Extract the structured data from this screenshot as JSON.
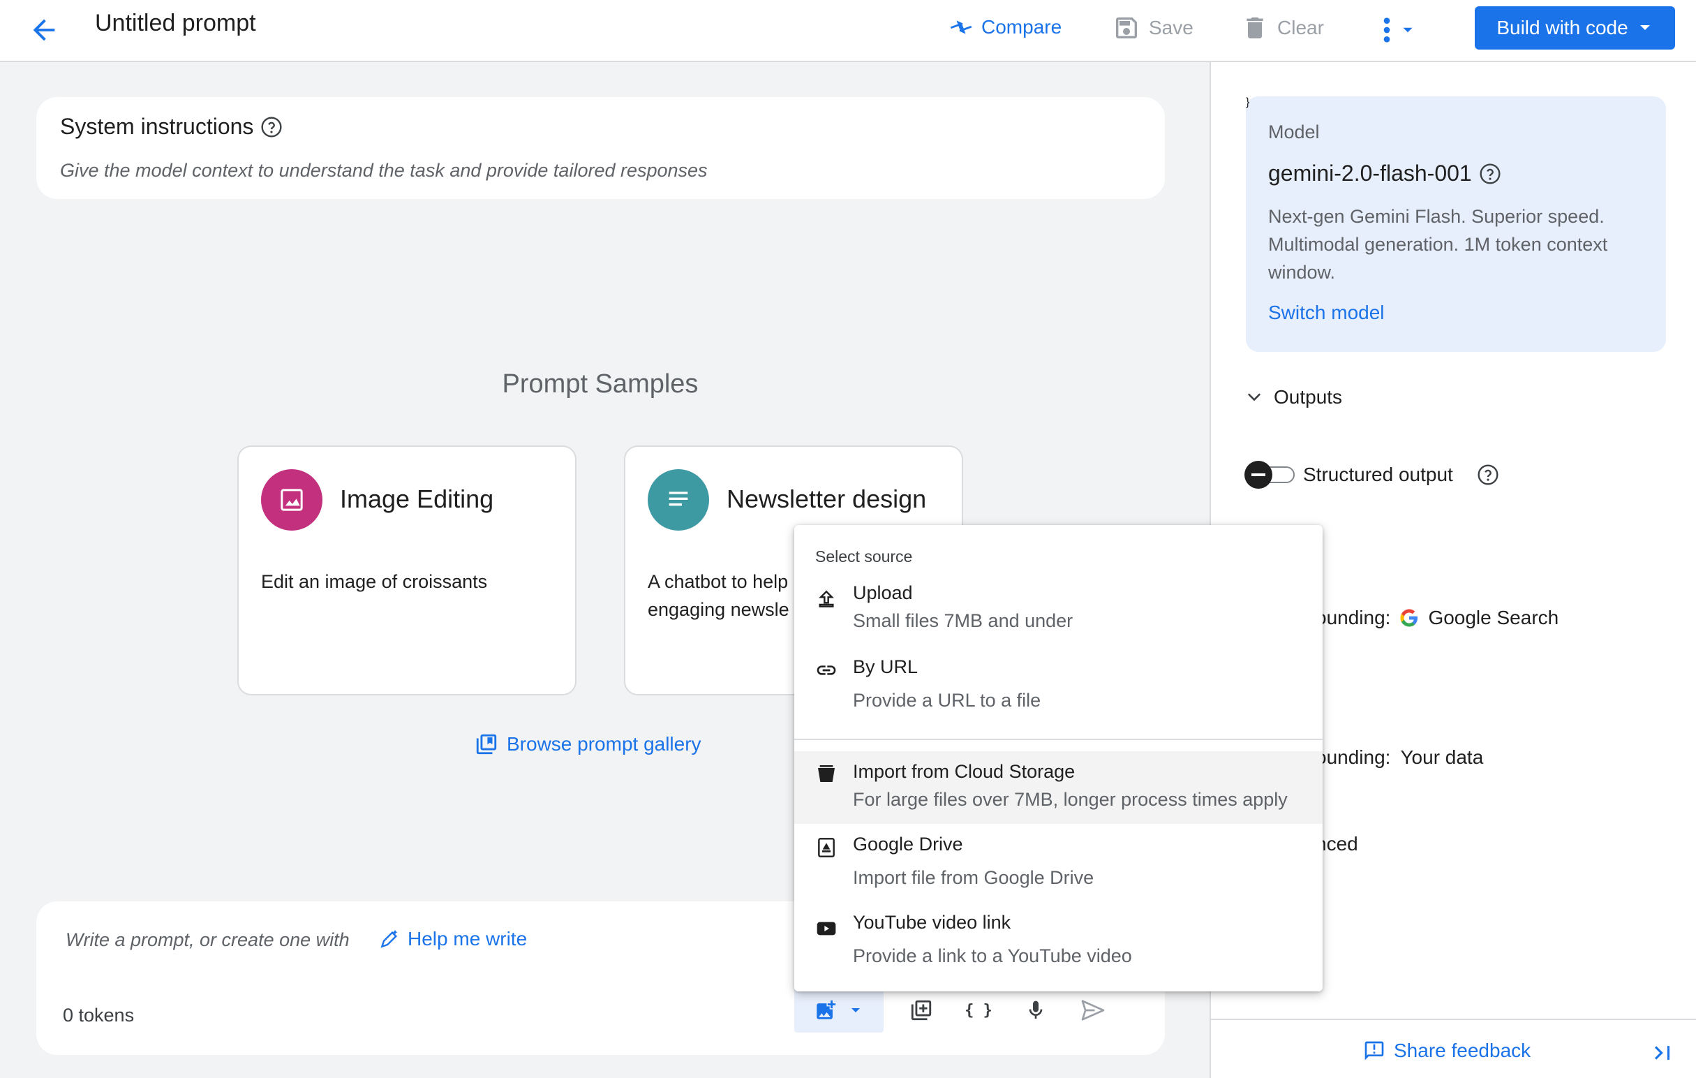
{
  "header": {
    "title": "Untitled prompt",
    "compare": "Compare",
    "save": "Save",
    "clear": "Clear",
    "build": "Build with code"
  },
  "system": {
    "title": "System instructions",
    "placeholder": "Give the model context to understand the task and provide tailored responses"
  },
  "samples": {
    "heading": "Prompt Samples",
    "cards": [
      {
        "title": "Image Editing",
        "desc": "Edit an image of croissants"
      },
      {
        "title": "Newsletter design",
        "desc_line1": "A chatbot to help",
        "desc_line2": "engaging newsle"
      }
    ],
    "gallery": "Browse prompt gallery"
  },
  "prompt": {
    "placeholder": "Write a prompt, or create one with",
    "help": "Help me write",
    "tokens": "0 tokens"
  },
  "menu": {
    "heading": "Select source",
    "items": [
      {
        "title": "Upload",
        "sub": "Small files 7MB and under"
      },
      {
        "title": "By URL",
        "sub": "Provide a URL to a file"
      },
      {
        "title": "Import from Cloud Storage",
        "sub": "For large files over 7MB, longer process times apply"
      },
      {
        "title": "Google Drive",
        "sub": "Import file from Google Drive"
      },
      {
        "title": "YouTube video link",
        "sub": "Provide a link to a YouTube video"
      }
    ]
  },
  "sidebar": {
    "model_label": "Model",
    "model_name": "gemini-2.0-flash-001",
    "model_desc_1": "Next-gen Gemini Flash. Superior speed.",
    "model_desc_2": "Multimodal generation. 1M token context",
    "model_desc_3": "window.",
    "switch": "Switch model",
    "outputs": "Outputs",
    "structured": "Structured output",
    "grounding1_prefix": "ounding:",
    "grounding1_value": "Google Search",
    "grounding2_prefix": "ounding:",
    "grounding2_value": "Your data",
    "advanced": "nced",
    "feedback": "Share feedback"
  },
  "colors": {
    "accent": "#1a73e8",
    "image_editing_circle": "#c2307e",
    "newsletter_circle": "#3d9aa3",
    "model_card": "#e8effc"
  }
}
